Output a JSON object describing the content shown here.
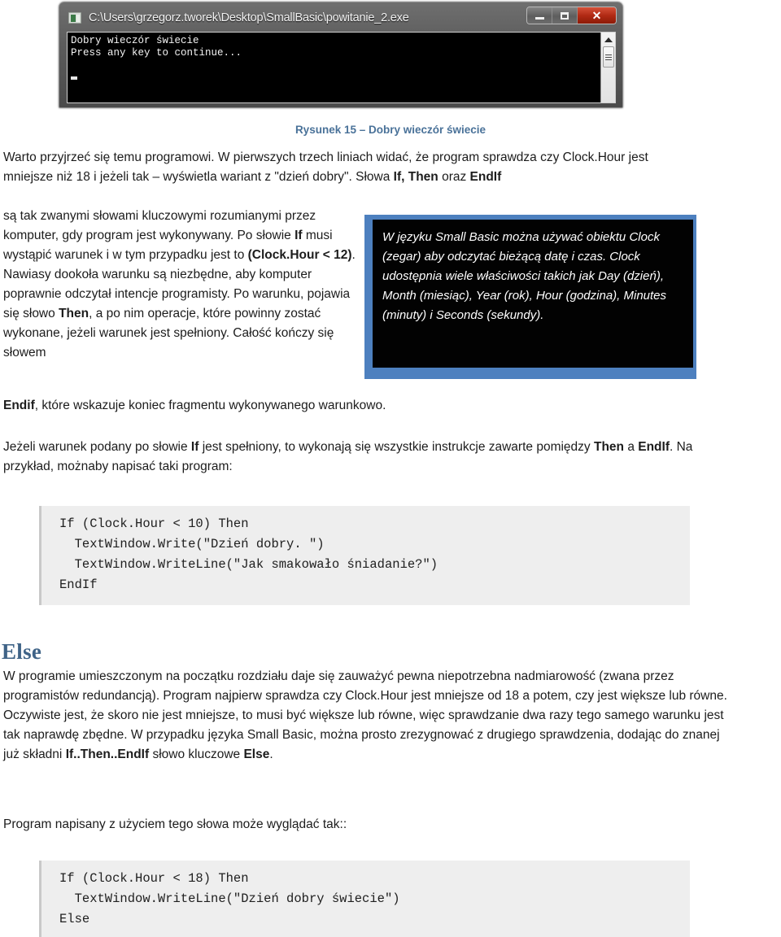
{
  "console_window": {
    "icon": "console-app-icon",
    "title": "C:\\Users\\grzegorz.tworek\\Desktop\\SmallBasic\\powitanie_2.exe",
    "buttons": {
      "minimize": "—",
      "maximize": "□",
      "close": "✕"
    },
    "output_line_1": "Dobry wieczór świecie",
    "output_line_2": "Press any key to continue..."
  },
  "figure": {
    "caption": "Rysunek 15 – Dobry wieczór świecie",
    "caption_color": "#4a7299"
  },
  "body": {
    "intro": "Warto przyjrzeć się temu programowi. W pierwszych trzech liniach widać, że program sprawdza czy Clock.Hour jest mniejsze niż 18 i jeżeli tak – wyświetla wariant z \"dzień dobry\". Słowa If, Then oraz EndIf",
    "wrap": "są tak zwanymi słowami kluczowymi rozumianymi przez komputer, gdy program jest wykonywany. Po słowie If musi wystąpić warunek i w tym przypadku jest to (Clock.Hour < 12). Nawiasy dookoła warunku są niezbędne, aby komputer poprawnie odczytał intencje programisty. Po warunku, pojawia się słowo Then, a po nim operacje, które powinny zostać wykonane, jeżeli warunek jest spełniony. Całość kończy się słowem",
    "tail": "Endif, które wskazuje koniec fragmentu wykonywanego warunkowo.",
    "after": "Jeżeli warunek podany po słowie If jest spełniony, to wykonają się wszystkie instrukcje zawarte pomiędzy Then a EndIf. Na przykład, możnaby napisać taki program:"
  },
  "callout": {
    "text": "W języku Small Basic można używać obiektu Clock (zegar) aby odczytać bieżącą datę i czas. Clock udostępnia wiele właściwości takich jak Day (dzień), Month (miesiąc), Year (rok), Hour (godzina), Minutes (minuty) i Seconds (sekundy).",
    "border_color": "#4d80bf",
    "background_color": "#020202",
    "text_color": "#ffffff"
  },
  "code_block_1": {
    "lines": [
      "If (Clock.Hour < 10) Then",
      "  TextWindow.Write(\"Dzień dobry. \")",
      "  TextWindow.WriteLine(\"Jak smakowało śniadanie?\")",
      "EndIf"
    ]
  },
  "code_block_2": {
    "lines": [
      "If (Clock.Hour < 18) Then",
      "  TextWindow.WriteLine(\"Dzień dobry świecie\")",
      "Else"
    ]
  },
  "section": {
    "heading": "Else",
    "heading_color": "#3f6387",
    "paragraph_1": "W programie umieszczonym na początku rozdziału daje się zauważyć pewna niepotrzebna nadmiarowość (zwana przez programistów redundancją). Program najpierw sprawdza czy Clock.Hour jest mniejsze od 18 a potem, czy jest większe lub równe. Oczywiste jest, że skoro nie jest mniejsze, to musi być większe lub równe, więc sprawdzanie dwa razy tego samego warunku jest tak naprawdę zbędne. W przypadku języka Small Basic, można prosto zrezygnować z drugiego sprawdzenia, dodając do znanej już składni If..Then..EndIf słowo kluczowe Else.",
    "paragraph_2": "Program napisany z użyciem tego słowa może wyglądać tak::"
  }
}
